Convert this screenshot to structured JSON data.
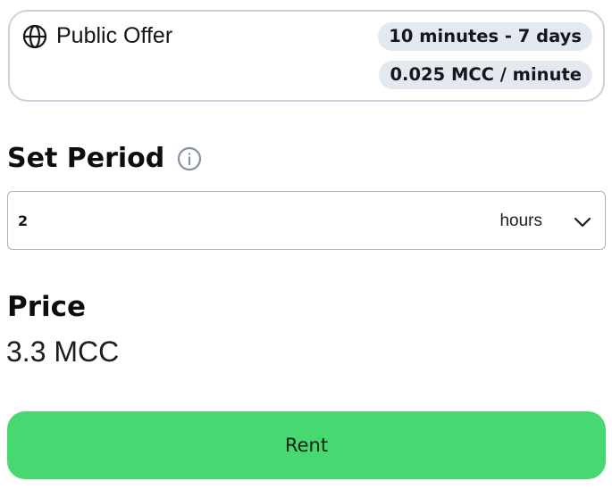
{
  "offer": {
    "icon": "globe-icon",
    "title": "Public Offer",
    "duration_range": "10 minutes - 7 days",
    "rate": "0.025 MCC / minute"
  },
  "period": {
    "heading": "Set Period",
    "info_icon": "info-icon",
    "value": "2",
    "unit": "hours",
    "dropdown_icon": "chevron-down-icon"
  },
  "price": {
    "heading": "Price",
    "value": "3.3 MCC"
  },
  "actions": {
    "rent_label": "Rent"
  },
  "colors": {
    "accent": "#48d872",
    "pill_background": "#e4e9f0",
    "card_border": "#c9d3df",
    "muted_icon": "#8592a3"
  }
}
